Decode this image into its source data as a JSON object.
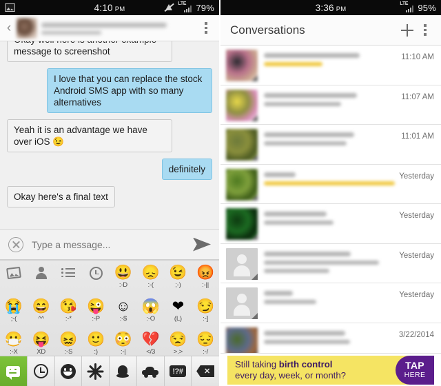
{
  "left": {
    "status": {
      "time": "4:10",
      "ampm": "PM",
      "battery": "79%",
      "lte": "LTE",
      "icons": [
        "gallery-icon",
        "mute-icon",
        "lte-signal-icon"
      ]
    },
    "appbar": {
      "back": "‹",
      "contact_name_redacted": "",
      "overflow": "overflow-menu"
    },
    "messages": [
      {
        "text": "Okay well here is another example message to screenshot",
        "side": "in",
        "clipped": true
      },
      {
        "text": "I love that you can replace the stock Android SMS app with so many alternatives",
        "side": "out",
        "clipped": false
      },
      {
        "text": "Yeah it is an advantage we have over iOS 😉",
        "side": "in",
        "clipped": false
      },
      {
        "text": "definitely",
        "side": "out",
        "clipped": false
      },
      {
        "text": "Okay here's a final text",
        "side": "in",
        "clipped": false
      }
    ],
    "composer": {
      "clear_label": "clear",
      "input_value": "",
      "placeholder": "Type a message...",
      "send_label": "send"
    },
    "keyboard": {
      "categories": [
        {
          "icon": "photos-icon",
          "glyph": "",
          "code": ""
        },
        {
          "icon": "person-icon",
          "glyph": "",
          "code": ""
        },
        {
          "icon": "list-icon",
          "glyph": "",
          "code": ""
        },
        {
          "icon": "clock-icon",
          "glyph": "",
          "code": ""
        },
        {
          "icon": "emoji-grin",
          "glyph": "😃",
          "code": ":-D"
        },
        {
          "icon": "emoji-sad",
          "glyph": "😞",
          "code": ":-("
        },
        {
          "icon": "emoji-wink",
          "glyph": "😉",
          "code": ";-)"
        },
        {
          "icon": "emoji-angry",
          "glyph": "😡",
          "code": ":-||"
        }
      ],
      "row2": [
        {
          "icon": "emoji-cry",
          "glyph": "😭",
          "code": ";-("
        },
        {
          "icon": "emoji-happy",
          "glyph": "😄",
          "code": "^^"
        },
        {
          "icon": "emoji-kiss",
          "glyph": "😘",
          "code": ":-*"
        },
        {
          "icon": "emoji-tongue",
          "glyph": "😜",
          "code": ":-P"
        },
        {
          "icon": "emoji-blush",
          "glyph": "☺",
          "code": ":-$"
        },
        {
          "icon": "emoji-scream",
          "glyph": "😱",
          "code": ":-O"
        },
        {
          "icon": "emoji-heart",
          "glyph": "❤",
          "code": "(L)"
        },
        {
          "icon": "emoji-smirk",
          "glyph": "😏",
          "code": ":-]"
        }
      ],
      "row3": [
        {
          "icon": "emoji-mask",
          "glyph": "😷",
          "code": ":-X"
        },
        {
          "icon": "emoji-xd",
          "glyph": "😝",
          "code": "XD"
        },
        {
          "icon": "emoji-confounded",
          "glyph": "😖",
          "code": ":-S"
        },
        {
          "icon": "emoji-smile",
          "glyph": "🙂",
          "code": ":)"
        },
        {
          "icon": "emoji-neutral",
          "glyph": "😳",
          "code": ":-|"
        },
        {
          "icon": "emoji-broken-heart",
          "glyph": "💔",
          "code": "</3"
        },
        {
          "icon": "emoji-unamused",
          "glyph": "😒",
          "code": ">.>"
        },
        {
          "icon": "emoji-pensive",
          "glyph": "😔",
          "code": ":-/"
        }
      ],
      "bottom_bar": [
        {
          "icon": "sms-emoticon-key",
          "label": "",
          "active": true
        },
        {
          "icon": "recent-clock-key",
          "label": "",
          "active": false
        },
        {
          "icon": "smiley-key",
          "label": "",
          "active": false
        },
        {
          "icon": "nature-flower-key",
          "label": "",
          "active": false
        },
        {
          "icon": "objects-bell-key",
          "label": "",
          "active": false
        },
        {
          "icon": "places-car-key",
          "label": "",
          "active": false
        },
        {
          "icon": "symbols-key",
          "label": "!?#",
          "active": false
        },
        {
          "icon": "backspace-key",
          "label": "✕",
          "active": false
        }
      ]
    }
  },
  "right": {
    "status": {
      "time": "3:36",
      "ampm": "PM",
      "battery": "95%",
      "lte": "LTE",
      "icons": [
        "lte-signal-icon"
      ]
    },
    "appbar": {
      "title": "Conversations",
      "new_label": "new-conversation",
      "overflow": "overflow-menu"
    },
    "conversations": [
      {
        "time": "11:10 AM",
        "avatar": "photo",
        "avatar_colors": [
          "#2a2a30",
          "#b8708a",
          "#caa48f",
          "#efe4dc"
        ],
        "lines": [
          72,
          44
        ],
        "highlight_line": 1
      },
      {
        "time": "11:07 AM",
        "avatar": "photo",
        "avatar_colors": [
          "#e8d84a",
          "#8f8f42",
          "#d98fb8",
          "#f2f2f2"
        ],
        "lines": [
          70,
          58
        ],
        "highlight_line": -1
      },
      {
        "time": "11:01 AM",
        "avatar": "photo",
        "avatar_colors": [
          "#6d7a3a",
          "#8a8f3c",
          "#4c5a22",
          "#9fb052"
        ],
        "lines": [
          68,
          62
        ],
        "highlight_line": -1
      },
      {
        "time": "Yesterday",
        "avatar": "photo",
        "avatar_colors": [
          "#4e7a20",
          "#7fa03c",
          "#3d5c18",
          "#a8c46a"
        ],
        "lines": [
          24,
          100
        ],
        "highlight_line": 1
      },
      {
        "time": "Yesterday",
        "avatar": "photo",
        "avatar_colors": [
          "#0d3a10",
          "#1c6b22",
          "#0a2a0c",
          "#2f8a33"
        ],
        "lines": [
          48,
          53
        ],
        "highlight_line": -1
      },
      {
        "time": "Yesterday",
        "avatar": "person",
        "avatar_colors": [],
        "lines": [
          66,
          88,
          50
        ],
        "highlight_line": -1
      },
      {
        "time": "Yesterday",
        "avatar": "person",
        "avatar_colors": [],
        "lines": [
          22,
          40
        ],
        "highlight_line": -1
      },
      {
        "time": "3/22/2014",
        "avatar": "photo",
        "avatar_colors": [
          "#4a6a2a",
          "#5c6a8a",
          "#a0673c",
          "#2f3a5c"
        ],
        "lines": [
          62,
          66
        ],
        "highlight_line": -1
      }
    ],
    "ad": {
      "line1_plain": "Still taking ",
      "line1_bold": "birth control",
      "line2": "every day, week, or month?",
      "tap_line1": "TAP",
      "tap_line2": "HERE",
      "bg": "#f5e463",
      "accent": "#5b1d8c"
    }
  }
}
